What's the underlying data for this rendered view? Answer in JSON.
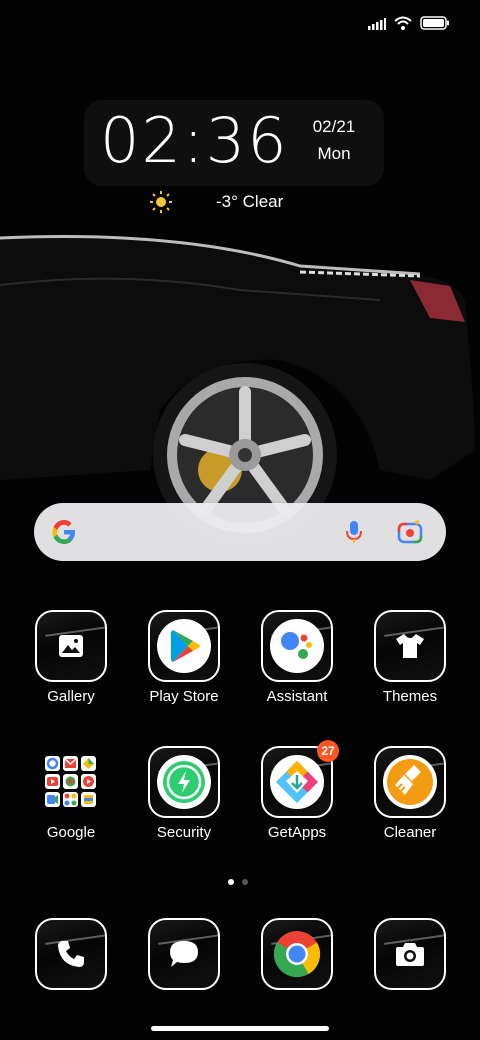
{
  "status_bar": {
    "signal_icon": "signal-icon",
    "wifi_icon": "wifi-icon",
    "battery_icon": "battery-icon"
  },
  "clock": {
    "time": "02:36",
    "date": "02/21",
    "day": "Mon"
  },
  "weather": {
    "icon": "sun-icon",
    "text": "-3° Clear"
  },
  "search_bar": {
    "logo": "google-g-icon",
    "mic": "mic-icon",
    "lens": "lens-icon"
  },
  "apps": [
    {
      "label": "Gallery",
      "icon": "gallery-icon"
    },
    {
      "label": "Play Store",
      "icon": "play-store-icon"
    },
    {
      "label": "Assistant",
      "icon": "assistant-icon"
    },
    {
      "label": "Themes",
      "icon": "themes-icon"
    },
    {
      "label": "Google",
      "icon": "google-folder-icon"
    },
    {
      "label": "Security",
      "icon": "security-icon"
    },
    {
      "label": "GetApps",
      "icon": "getapps-icon",
      "badge": "27"
    },
    {
      "label": "Cleaner",
      "icon": "cleaner-icon"
    }
  ],
  "page_indicator": {
    "pages": 2,
    "current": 1
  },
  "dock": [
    {
      "icon": "phone-icon"
    },
    {
      "icon": "messages-icon"
    },
    {
      "icon": "chrome-icon"
    },
    {
      "icon": "camera-icon"
    }
  ],
  "colors": {
    "badge": "#ff5722",
    "accent_green": "#2ecc71",
    "cleaner_orange": "#f39c12"
  }
}
